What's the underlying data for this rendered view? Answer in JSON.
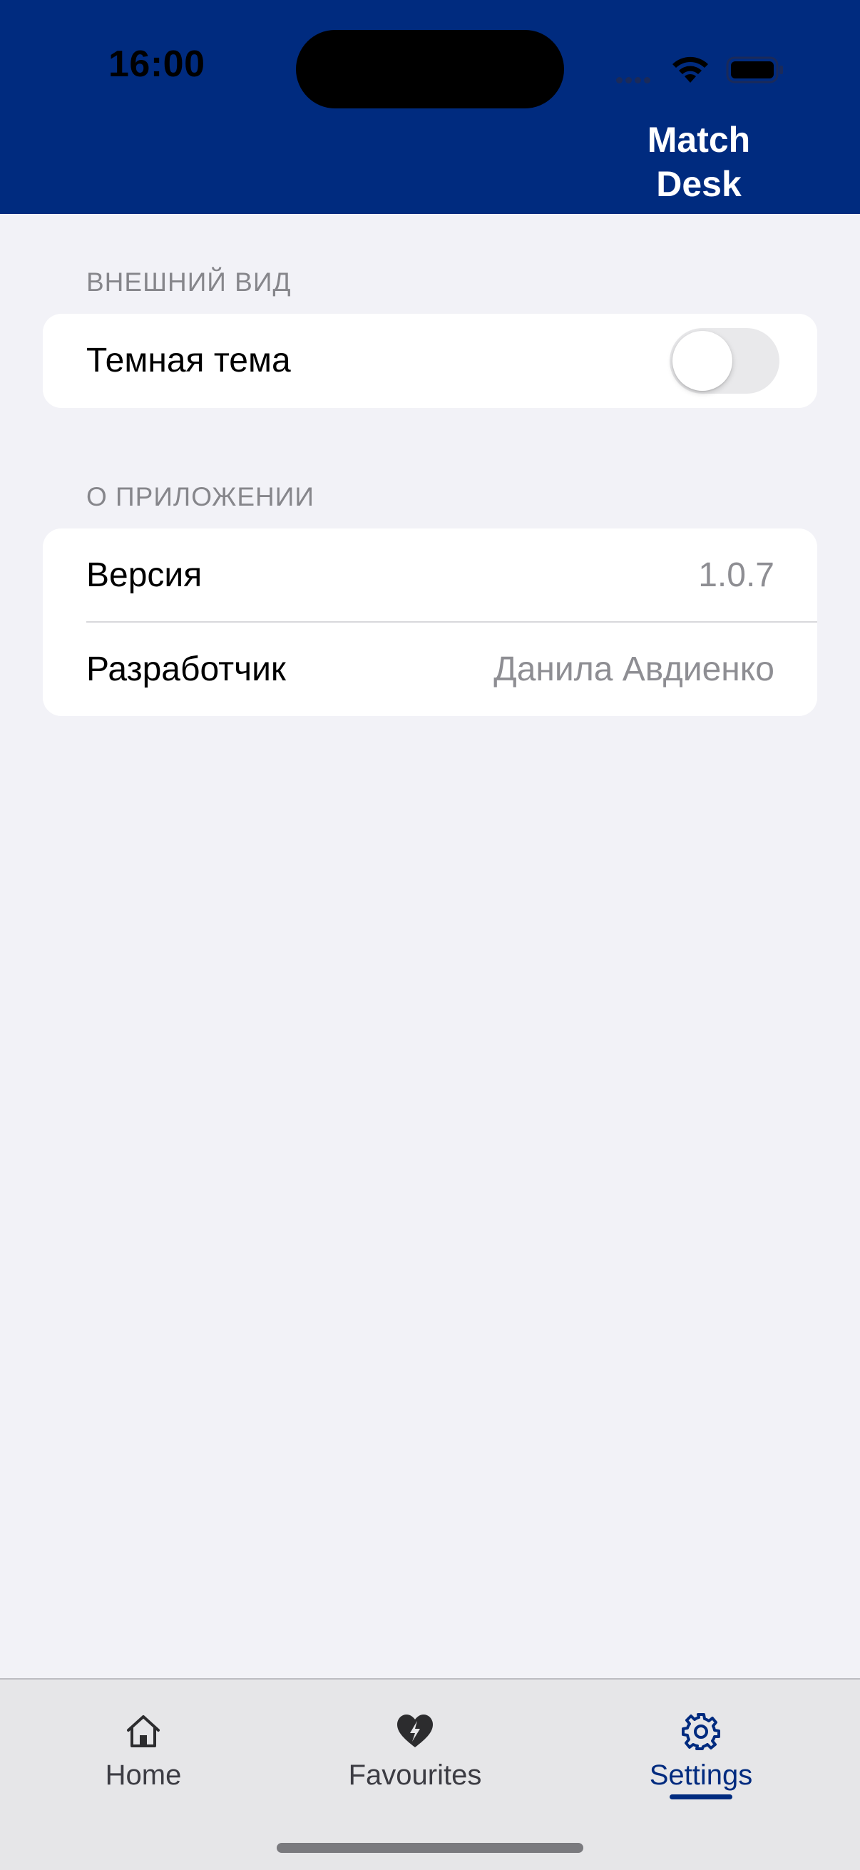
{
  "status_bar": {
    "time": "16:00"
  },
  "header": {
    "title_line1": "Match",
    "title_line2": "Desk"
  },
  "sections": {
    "appearance": {
      "label": "ВНЕШНИЙ ВИД",
      "dark_theme_label": "Темная тема",
      "dark_theme_enabled": false
    },
    "about": {
      "label": "О ПРИЛОЖЕНИИ",
      "version_label": "Версия",
      "version_value": "1.0.7",
      "developer_label": "Разработчик",
      "developer_value": "Данила Авдиенко"
    }
  },
  "tabbar": {
    "tabs": [
      {
        "label": "Home",
        "icon": "home-icon",
        "active": false
      },
      {
        "label": "Favourites",
        "icon": "heart-bolt-icon",
        "active": false
      },
      {
        "label": "Settings",
        "icon": "gear-icon",
        "active": true
      }
    ]
  },
  "colors": {
    "brand": "#002B7F",
    "background": "#F2F2F7",
    "secondary_text": "#8E8E93"
  }
}
